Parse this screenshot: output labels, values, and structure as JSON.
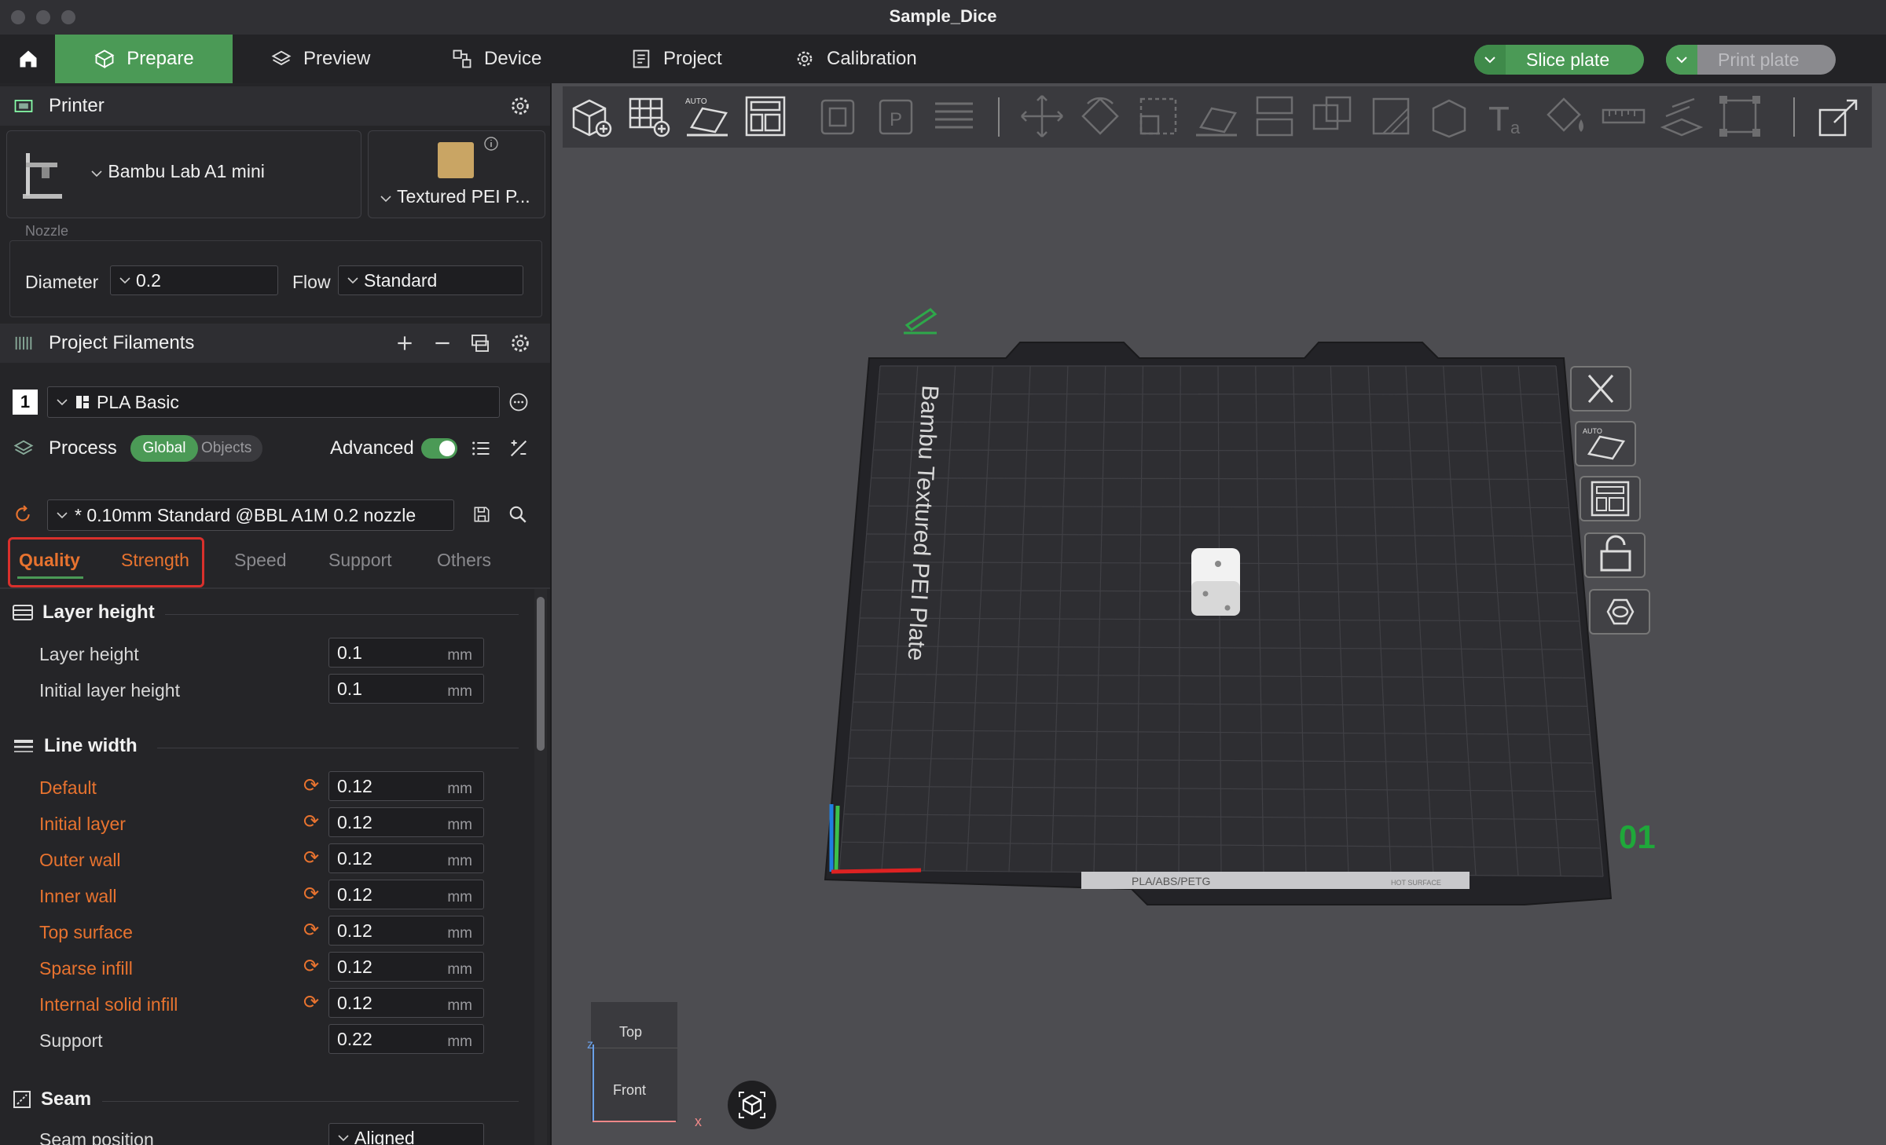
{
  "window": {
    "title": "Sample_Dice"
  },
  "menubar": {
    "tabs": [
      {
        "label": "Prepare"
      },
      {
        "label": "Preview"
      },
      {
        "label": "Device"
      },
      {
        "label": "Project"
      },
      {
        "label": "Calibration"
      }
    ],
    "slice_label": "Slice plate",
    "print_label": "Print plate"
  },
  "printer": {
    "section_title": "Printer",
    "printer_name": "Bambu Lab A1 mini",
    "plate_name": "Textured PEI P...",
    "nozzle_label": "Nozzle",
    "diameter_label": "Diameter",
    "diameter_value": "0.2",
    "flow_label": "Flow",
    "flow_value": "Standard"
  },
  "filaments": {
    "section_title": "Project Filaments",
    "items": [
      {
        "index": "1",
        "name": "PLA Basic"
      }
    ]
  },
  "process": {
    "section_title": "Process",
    "toggle_global": "Global",
    "toggle_objects": "Objects",
    "advanced_label": "Advanced",
    "preset": "* 0.10mm Standard @BBL A1M 0.2 nozzle",
    "tabs": [
      "Quality",
      "Strength",
      "Speed",
      "Support",
      "Others"
    ],
    "groups": {
      "layer_height": {
        "title": "Layer height",
        "rows": [
          {
            "label": "Layer height",
            "value": "0.1",
            "unit": "mm"
          },
          {
            "label": "Initial layer height",
            "value": "0.1",
            "unit": "mm"
          }
        ]
      },
      "line_width": {
        "title": "Line width",
        "rows": [
          {
            "label": "Default",
            "value": "0.12",
            "unit": "mm"
          },
          {
            "label": "Initial layer",
            "value": "0.12",
            "unit": "mm"
          },
          {
            "label": "Outer wall",
            "value": "0.12",
            "unit": "mm"
          },
          {
            "label": "Inner wall",
            "value": "0.12",
            "unit": "mm"
          },
          {
            "label": "Top surface",
            "value": "0.12",
            "unit": "mm"
          },
          {
            "label": "Sparse infill",
            "value": "0.12",
            "unit": "mm"
          },
          {
            "label": "Internal solid infill",
            "value": "0.12",
            "unit": "mm"
          },
          {
            "label": "Support",
            "value": "0.22",
            "unit": "mm"
          }
        ]
      },
      "seam": {
        "title": "Seam",
        "rows": [
          {
            "label": "Seam position",
            "value": "Aligned"
          }
        ]
      }
    }
  },
  "viewport": {
    "plate_text": "Bambu Textured PEI Plate",
    "plate_material": "PLA/ABS/PETG",
    "plate_surface": "HOT SURFACE",
    "plate_number": "01",
    "nav_cube_top": "Top",
    "nav_cube_front": "Front",
    "axis_x": "x",
    "axis_z": "z"
  },
  "colors": {
    "accent": "#4b9a56",
    "modified": "#e8732f",
    "highlight_box": "#d9302c"
  }
}
